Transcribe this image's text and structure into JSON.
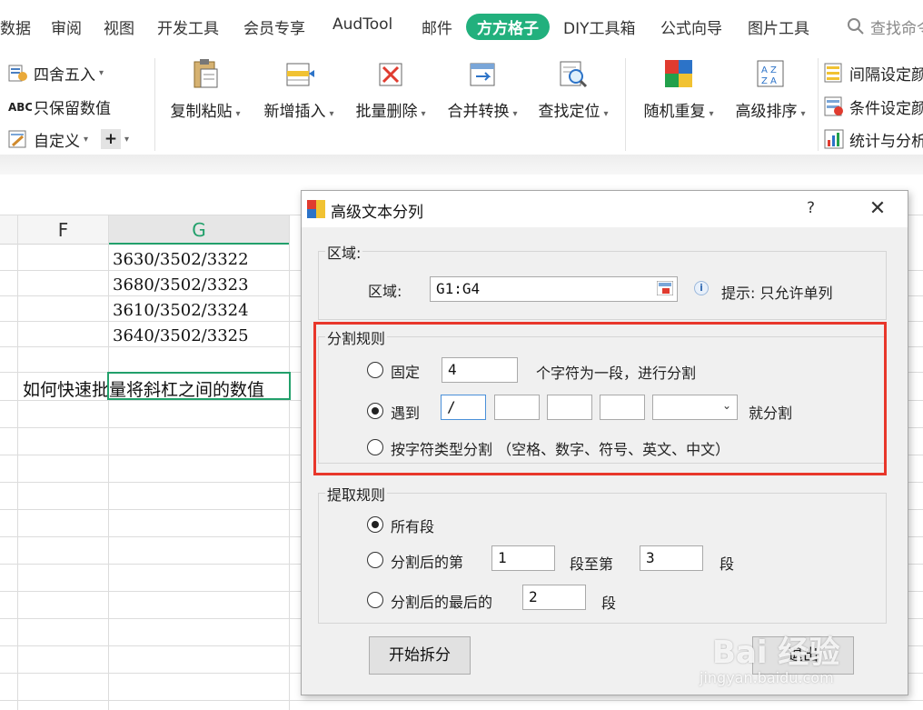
{
  "ribbon_tabs": [
    "数据",
    "审阅",
    "视图",
    "开发工具",
    "会员专享",
    "AudTool",
    "邮件",
    "方方格子",
    "DIY工具箱",
    "公式向导",
    "图片工具"
  ],
  "search_placeholder": "查找命令",
  "ribbon": {
    "round_label": "四舍五入",
    "keep_values_label": "只保留数值",
    "custom_label": "自定义",
    "copy_paste_label": "复制粘贴",
    "insert_label": "新增插入",
    "batch_delete_label": "批量删除",
    "merge_convert_label": "合并转换",
    "find_locate_label": "查找定位",
    "random_repeat_label": "随机重复",
    "advanced_sort_label": "高级排序",
    "interval_color_label": "间隔设定颜色",
    "cond_color_label": "条件设定颜色",
    "stats_group_label": "统计与分析"
  },
  "sheet": {
    "col_f": "F",
    "col_g": "G",
    "cells": [
      "3630/3502/3322",
      "3680/3502/3323",
      "3610/3502/3324",
      "3640/3502/3325"
    ],
    "note": "如何快速批量将斜杠之间的数值"
  },
  "dialog": {
    "title": "高级文本分列",
    "help": "?",
    "close": "✕",
    "region_group": "区域:",
    "region_label": "区域:",
    "region_value": "G1:G4",
    "region_hint": "提示: 只允许单列",
    "split_group": "分割规则",
    "fixed_label": "固定",
    "fixed_value": "4",
    "fixed_suffix": "个字符为一段，进行分割",
    "meet_label": "遇到",
    "meet_value1": "/",
    "meet_value2": "",
    "meet_value3": "",
    "meet_value4": "",
    "meet_suffix": "就分割",
    "type_label": "按字符类型分割 （空格、数字、符号、英文、中文）",
    "extract_group": "提取规则",
    "all_label": "所有段",
    "after_label": "分割后的第",
    "after_from": "1",
    "after_mid": "段至第",
    "after_to": "3",
    "after_suffix": "段",
    "last_label": "分割后的最后的",
    "last_value": "2",
    "last_suffix": "段",
    "start_button": "开始拆分",
    "exit_button": "退出"
  },
  "colors": {
    "accent": "#22b07d",
    "highlight": "#e8372b"
  },
  "watermark": {
    "line1": "Bai 经验",
    "line2": "jingyan.baidu.com"
  }
}
